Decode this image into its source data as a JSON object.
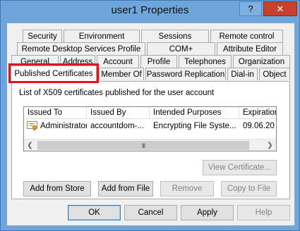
{
  "window": {
    "title": "user1 Properties",
    "help_label": "?",
    "close_label": "✕"
  },
  "tabs": {
    "row1": [
      "Security",
      "Environment",
      "Sessions",
      "Remote control"
    ],
    "row2": [
      "Remote Desktop Services Profile",
      "COM+",
      "Attribute Editor"
    ],
    "row3": [
      "General",
      "Address",
      "Account",
      "Profile",
      "Telephones",
      "Organization"
    ],
    "row4": [
      "Published Certificates",
      "Member Of",
      "Password Replication",
      "Dial-in",
      "Object"
    ],
    "active": "Published Certificates"
  },
  "panel": {
    "caption": "List of X509 certificates published for the user account",
    "columns": [
      "Issued To",
      "Issued By",
      "Intended Purposes",
      "Expiration"
    ],
    "rows": [
      {
        "icon": "certificate-icon",
        "issued_to": "Administrator",
        "issued_by": "accountdom-...",
        "purposes": "Encrypting File Syste...",
        "expiration": "09.06.20"
      }
    ],
    "scroll_thumb": "III",
    "view_certificate": "View Certificate...",
    "add_from_store": "Add from Store",
    "add_from_file": "Add from File",
    "remove": "Remove",
    "copy_to_file": "Copy to File"
  },
  "footer": {
    "ok": "OK",
    "cancel": "Cancel",
    "apply": "Apply",
    "help": "Help"
  },
  "colors": {
    "title_bar": "#6ea6dc",
    "close_button": "#c7412f",
    "highlight": "#e0141c"
  }
}
